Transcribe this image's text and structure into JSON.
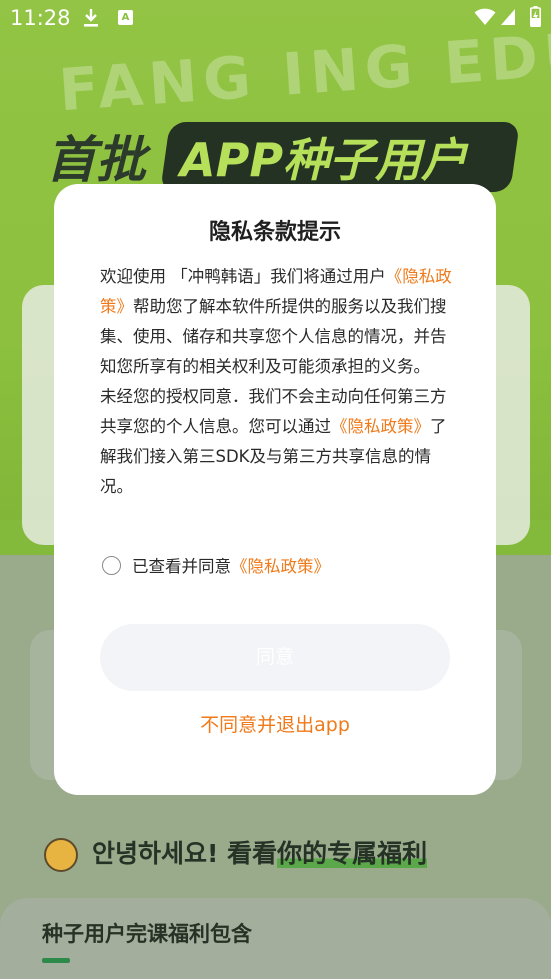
{
  "status_bar": {
    "time": "11:28",
    "download_icon": "download-icon",
    "notification_icon": "a-square-icon",
    "notification_letter": "A",
    "wifi_icon": "wifi-icon",
    "signal_icon": "signal-icon",
    "battery_icon": "battery-charging-icon"
  },
  "background": {
    "watermark": "FANG ING EDU",
    "title_left": "首批",
    "title_right": "APP种子用户",
    "greeting_korean": "안녕하세요!",
    "greeting_plain": "看看",
    "greeting_highlight": "你的专属福利",
    "panel_title": "种子用户完课福利包含",
    "hero_color": "#8cc03e"
  },
  "dialog": {
    "title": "隐私条款提示",
    "paragraph1": {
      "before_link": "欢迎使用 「冲鸭韩语」我们将通过用户",
      "link": "《隐私政策》",
      "after_link": "帮助您了解本软件所提供的服务以及我们搜集、使用、储存和共享您个人信息的情况，并告知您所享有的相关权利及可能须承担的义务。"
    },
    "paragraph2": {
      "before_link": " 未经您的授权同意．我们不会主动向任何第三方共享您的个人信息。您可以通过",
      "link": "《隐私政策》",
      "after_link": "了解我们接入第三SDK及与第三方共享信息的情况。"
    },
    "agree_checkbox": {
      "checked": false,
      "label": "已查看并同意",
      "link": "《隐私政策》"
    },
    "agree_button": "同意",
    "exit_button": "不同意并退出app",
    "accent_color": "#f07a1a"
  }
}
